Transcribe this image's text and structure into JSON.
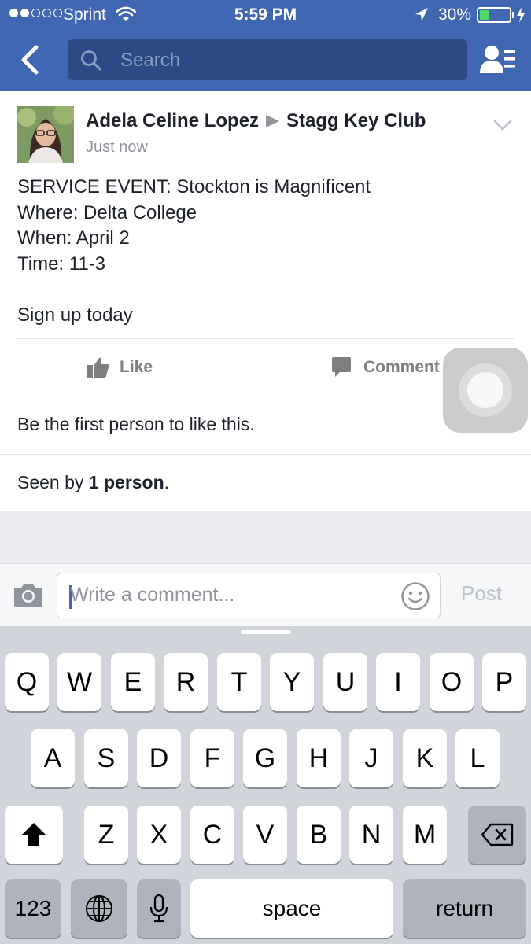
{
  "status_bar": {
    "carrier": "Sprint",
    "time": "5:59 PM",
    "battery_percent": "30%",
    "battery_level": 0.3,
    "signal_bars_filled": 2,
    "signal_bars_total": 5,
    "icons": [
      "wifi-icon",
      "location-arrow-icon",
      "battery-icon",
      "charging-bolt-icon"
    ]
  },
  "nav": {
    "back_icon": "back-chevron-icon",
    "search_placeholder": "Search",
    "search_icon": "search-icon",
    "friends_icon": "friend-requests-icon",
    "color": "#4267b2"
  },
  "post": {
    "author": "Adela Celine Lopez",
    "group": "Stagg Key Club",
    "timestamp": "Just now",
    "lines": [
      "SERVICE EVENT: Stockton is Magnificent",
      "Where: Delta College",
      "When: April 2",
      "Time: 11-3",
      "",
      "Sign up today"
    ],
    "like_label": "Like",
    "comment_label": "Comment",
    "likes_text": "Be the first person to like this.",
    "seen_prefix": "Seen by ",
    "seen_count": "1 person",
    "seen_suffix": "."
  },
  "comment_bar": {
    "placeholder": "Write a comment...",
    "post_label": "Post",
    "camera_icon": "camera-icon",
    "emoji_icon": "smiley-icon"
  },
  "keyboard": {
    "row1": [
      "Q",
      "W",
      "E",
      "R",
      "T",
      "Y",
      "U",
      "I",
      "O",
      "P"
    ],
    "row2": [
      "A",
      "S",
      "D",
      "F",
      "G",
      "H",
      "J",
      "K",
      "L"
    ],
    "row3": [
      "Z",
      "X",
      "C",
      "V",
      "B",
      "N",
      "M"
    ],
    "numbers_label": "123",
    "space_label": "space",
    "return_label": "return",
    "icons": [
      "shift-icon",
      "backspace-icon",
      "globe-icon",
      "microphone-icon"
    ]
  }
}
